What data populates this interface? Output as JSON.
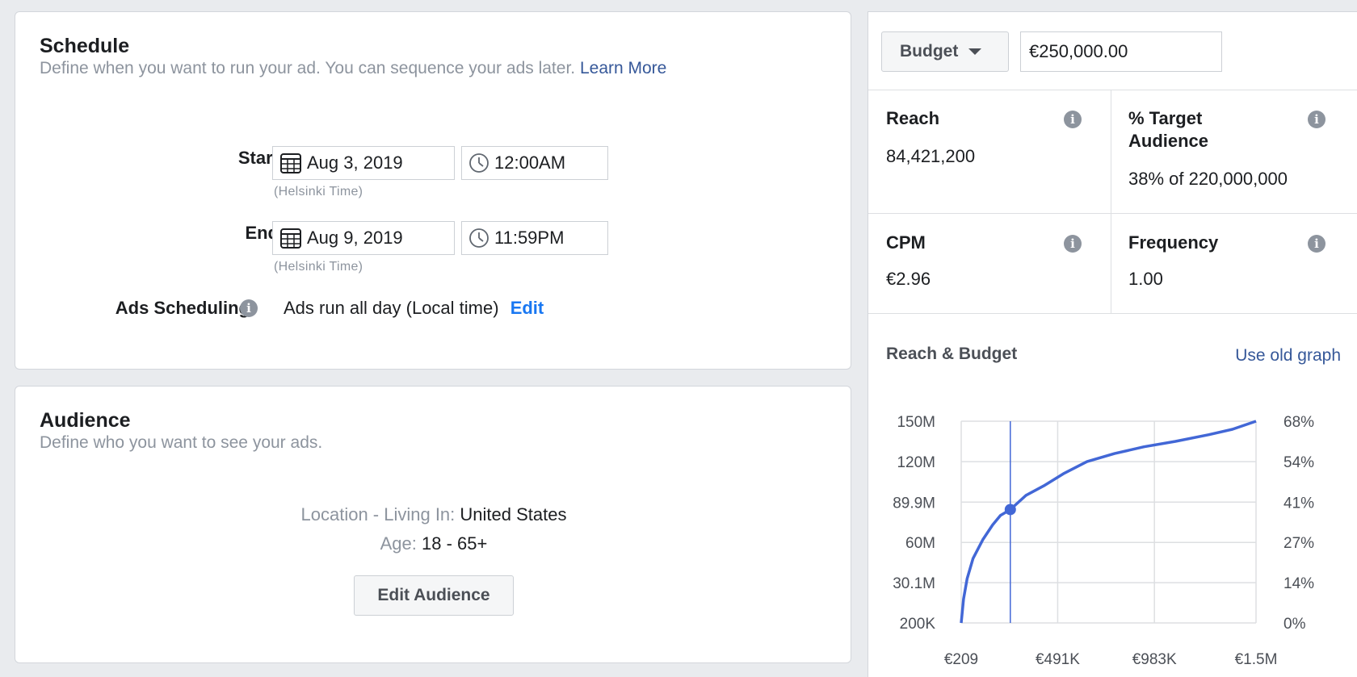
{
  "schedule": {
    "title": "Schedule",
    "subtitle": "Define when you want to run your ad. You can sequence your ads later.",
    "learn_more": "Learn More",
    "start_label": "Start",
    "start_date": "Aug 3, 2019",
    "start_time": "12:00AM",
    "start_tz": "(Helsinki Time)",
    "end_label": "End",
    "end_date": "Aug 9, 2019",
    "end_time": "11:59PM",
    "end_tz": "(Helsinki Time)",
    "ads_scheduling_label": "Ads Scheduling",
    "ads_scheduling_value": "Ads run all day (Local time)",
    "edit_label": "Edit"
  },
  "audience": {
    "title": "Audience",
    "subtitle": "Define who you want to see your ads.",
    "location_key": "Location - Living In:",
    "location_value": "United States",
    "age_key": "Age:",
    "age_value": "18 - 65+",
    "edit_button": "Edit Audience"
  },
  "budget": {
    "selector_label": "Budget",
    "amount": "€250,000.00"
  },
  "metrics": {
    "reach_label": "Reach",
    "reach_value": "84,421,200",
    "target_label_line1": "% Target",
    "target_label_line2": "Audience",
    "target_value": "38% of 220,000,000",
    "cpm_label": "CPM",
    "cpm_value": "€2.96",
    "frequency_label": "Frequency",
    "frequency_value": "1.00"
  },
  "graph": {
    "title": "Reach & Budget",
    "old_graph_link": "Use old graph"
  },
  "icons": {
    "info": "info-icon",
    "calendar": "calendar-icon",
    "clock": "clock-icon",
    "caret": "caret-down-icon"
  },
  "colors": {
    "accent_blue": "#1877f2",
    "link_blue": "#365899",
    "line_blue": "#4267d6"
  },
  "chart_data": {
    "type": "line",
    "title": "Reach & Budget",
    "x_tick_labels": [
      "€209",
      "€491K",
      "€983K",
      "€1.5M"
    ],
    "y_left_tick_labels": [
      "200K",
      "30.1M",
      "60M",
      "89.9M",
      "120M",
      "150M"
    ],
    "y_right_tick_labels": [
      "0%",
      "14%",
      "27%",
      "41%",
      "54%",
      "68%"
    ],
    "x_tick_values": [
      209,
      491000,
      983000,
      1500000
    ],
    "y_tick_values": [
      200000,
      30100000,
      60000000,
      89900000,
      120000000,
      150000000
    ],
    "xlim": [
      209,
      1500000
    ],
    "ylim": [
      200000,
      150000000
    ],
    "grid": true,
    "series": [
      {
        "x": [
          209,
          12000,
          30000,
          60000,
          110000,
          160000,
          200000,
          250000,
          330000,
          420000,
          520000,
          640000,
          780000,
          930000,
          1090000,
          1260000,
          1380000,
          1500000
        ],
        "y": [
          200000,
          18000000,
          33000000,
          48000000,
          62000000,
          73000000,
          80000000,
          84400000,
          95000000,
          102000000,
          111000000,
          120000000,
          126000000,
          131000000,
          135000000,
          140000000,
          144000000,
          150000000
        ]
      }
    ],
    "selected_point": {
      "x": 250000,
      "y": 84421200
    }
  }
}
